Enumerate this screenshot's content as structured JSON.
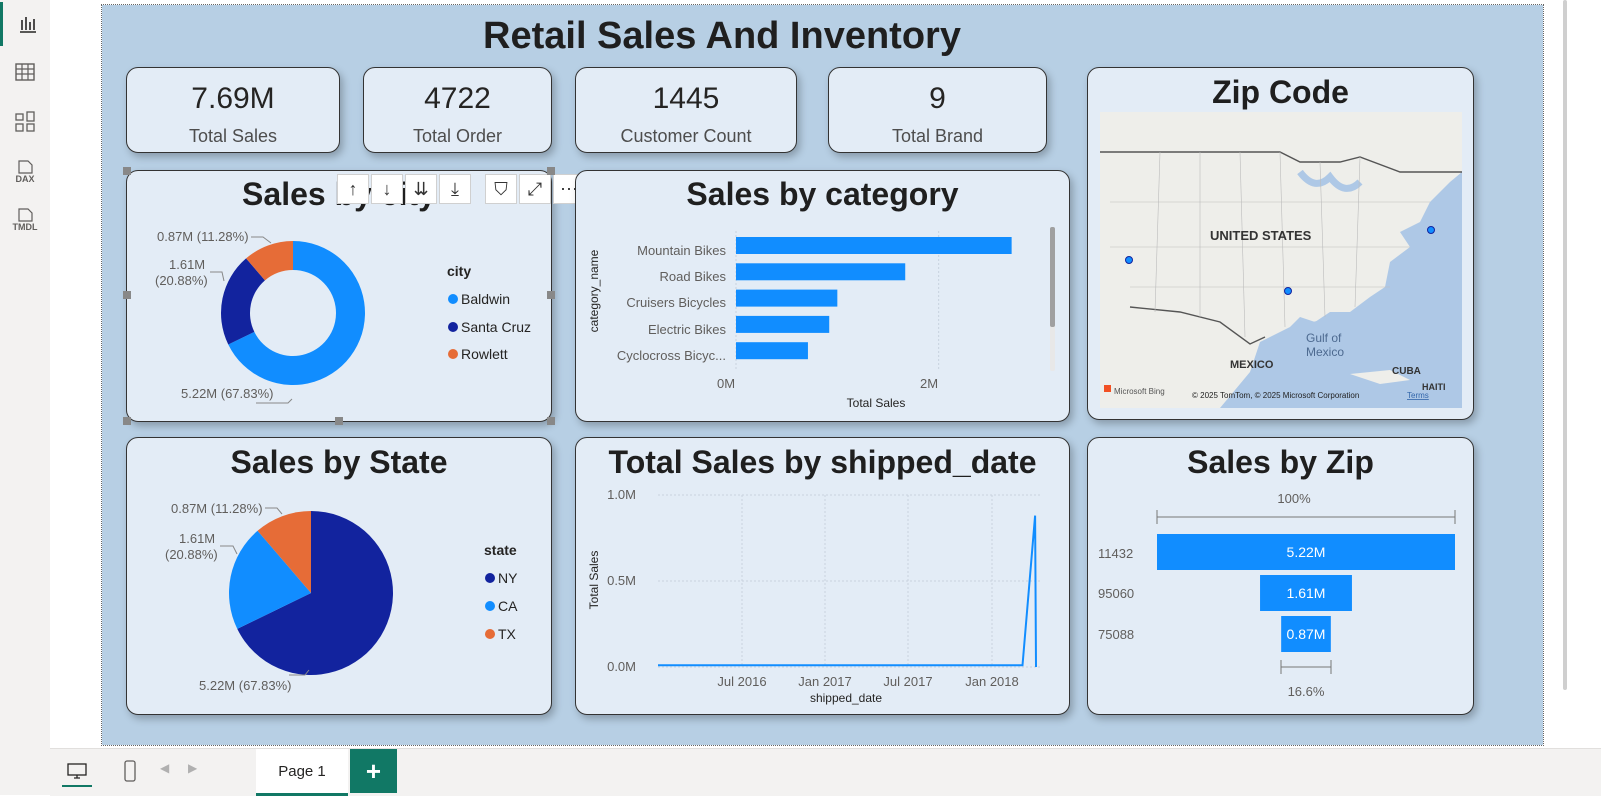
{
  "report": {
    "title": "Retail Sales And Inventory"
  },
  "left_rail": {
    "dax_label": "DAX",
    "tmdl_label": "TMDL"
  },
  "kpis": [
    {
      "value": "7.69M",
      "label": "Total Sales"
    },
    {
      "value": "4722",
      "label": "Total Order"
    },
    {
      "value": "1445",
      "label": "Customer Count"
    },
    {
      "value": "9",
      "label": "Total Brand"
    }
  ],
  "map": {
    "title": "Zip Code",
    "labels": {
      "us": "UNITED STATES",
      "mexico": "MEXICO",
      "gulf_line1": "Gulf of",
      "gulf_line2": "Mexico",
      "cuba": "CUBA",
      "haiti": "HAITI"
    },
    "attribution": "© 2025 TomTom, © 2025 Microsoft Corporation",
    "terms": "Terms",
    "brand": "Microsoft Bing"
  },
  "city_chart": {
    "chart_data": {
      "type": "pie",
      "title": "Sales by city",
      "legend_title": "city",
      "legend_position": "right",
      "donut": true,
      "slices": [
        {
          "name": "Baldwin",
          "value": 5.22,
          "label": "5.22M (67.83%)",
          "color": "#118dff"
        },
        {
          "name": "Santa Cruz",
          "value": 1.61,
          "label_line1": "1.61M",
          "label_line2": "(20.88%)",
          "color": "#12239e"
        },
        {
          "name": "Rowlett",
          "value": 0.87,
          "label": "0.87M (11.28%)",
          "color": "#e66c37"
        }
      ]
    }
  },
  "category_chart": {
    "chart_data": {
      "type": "bar",
      "orientation": "horizontal",
      "title": "Sales by category",
      "ylabel": "category_name",
      "xlabel": "Total Sales",
      "categories": [
        "Mountain Bikes",
        "Road Bikes",
        "Cruisers Bicycles",
        "Electric Bikes",
        "Cyclocross Bicyc..."
      ],
      "values": [
        2.72,
        1.67,
        1.0,
        0.92,
        0.71
      ],
      "xlim": [
        0,
        3.0
      ],
      "xticks": [
        "0M",
        "2M"
      ],
      "color": "#118dff"
    }
  },
  "state_chart": {
    "chart_data": {
      "type": "pie",
      "title": "Sales by State",
      "legend_title": "state",
      "legend_position": "right",
      "slices": [
        {
          "name": "NY",
          "value": 5.22,
          "label": "5.22M (67.83%)",
          "color": "#12239e"
        },
        {
          "name": "CA",
          "value": 1.61,
          "label_line1": "1.61M",
          "label_line2": "(20.88%)",
          "color": "#118dff"
        },
        {
          "name": "TX",
          "value": 0.87,
          "label": "0.87M (11.28%)",
          "color": "#e66c37"
        }
      ]
    }
  },
  "shipped_chart": {
    "chart_data": {
      "type": "line",
      "title": "Total Sales by shipped_date",
      "xlabel": "shipped_date",
      "ylabel": "Total Sales",
      "yticks": [
        "0.0M",
        "0.5M",
        "1.0M"
      ],
      "ylim": [
        0,
        1.0
      ],
      "xticks": [
        "Jul 2016",
        "Jan 2017",
        "Jul 2017",
        "Jan 2018"
      ],
      "x": [
        "2016-01",
        "2016-04",
        "2016-07",
        "2016-10",
        "2017-01",
        "2017-04",
        "2017-07",
        "2017-10",
        "2018-01",
        "2018-04",
        "2018-04-29",
        "2018-05"
      ],
      "values": [
        0.01,
        0.01,
        0.01,
        0.01,
        0.01,
        0.01,
        0.01,
        0.01,
        0.01,
        0.01,
        0.88,
        0.0
      ],
      "color": "#118dff"
    }
  },
  "zip_chart": {
    "chart_data": {
      "type": "bar",
      "subtype": "funnel",
      "title": "Sales by Zip",
      "categories": [
        "11432",
        "95060",
        "75088"
      ],
      "values": [
        5.22,
        1.61,
        0.87
      ],
      "value_labels": [
        "5.22M",
        "1.61M",
        "0.87M"
      ],
      "top_percent": "100%",
      "bottom_percent": "16.6%",
      "color": "#118dff"
    }
  },
  "bottom": {
    "page_tab": "Page 1",
    "add_label": "+"
  }
}
